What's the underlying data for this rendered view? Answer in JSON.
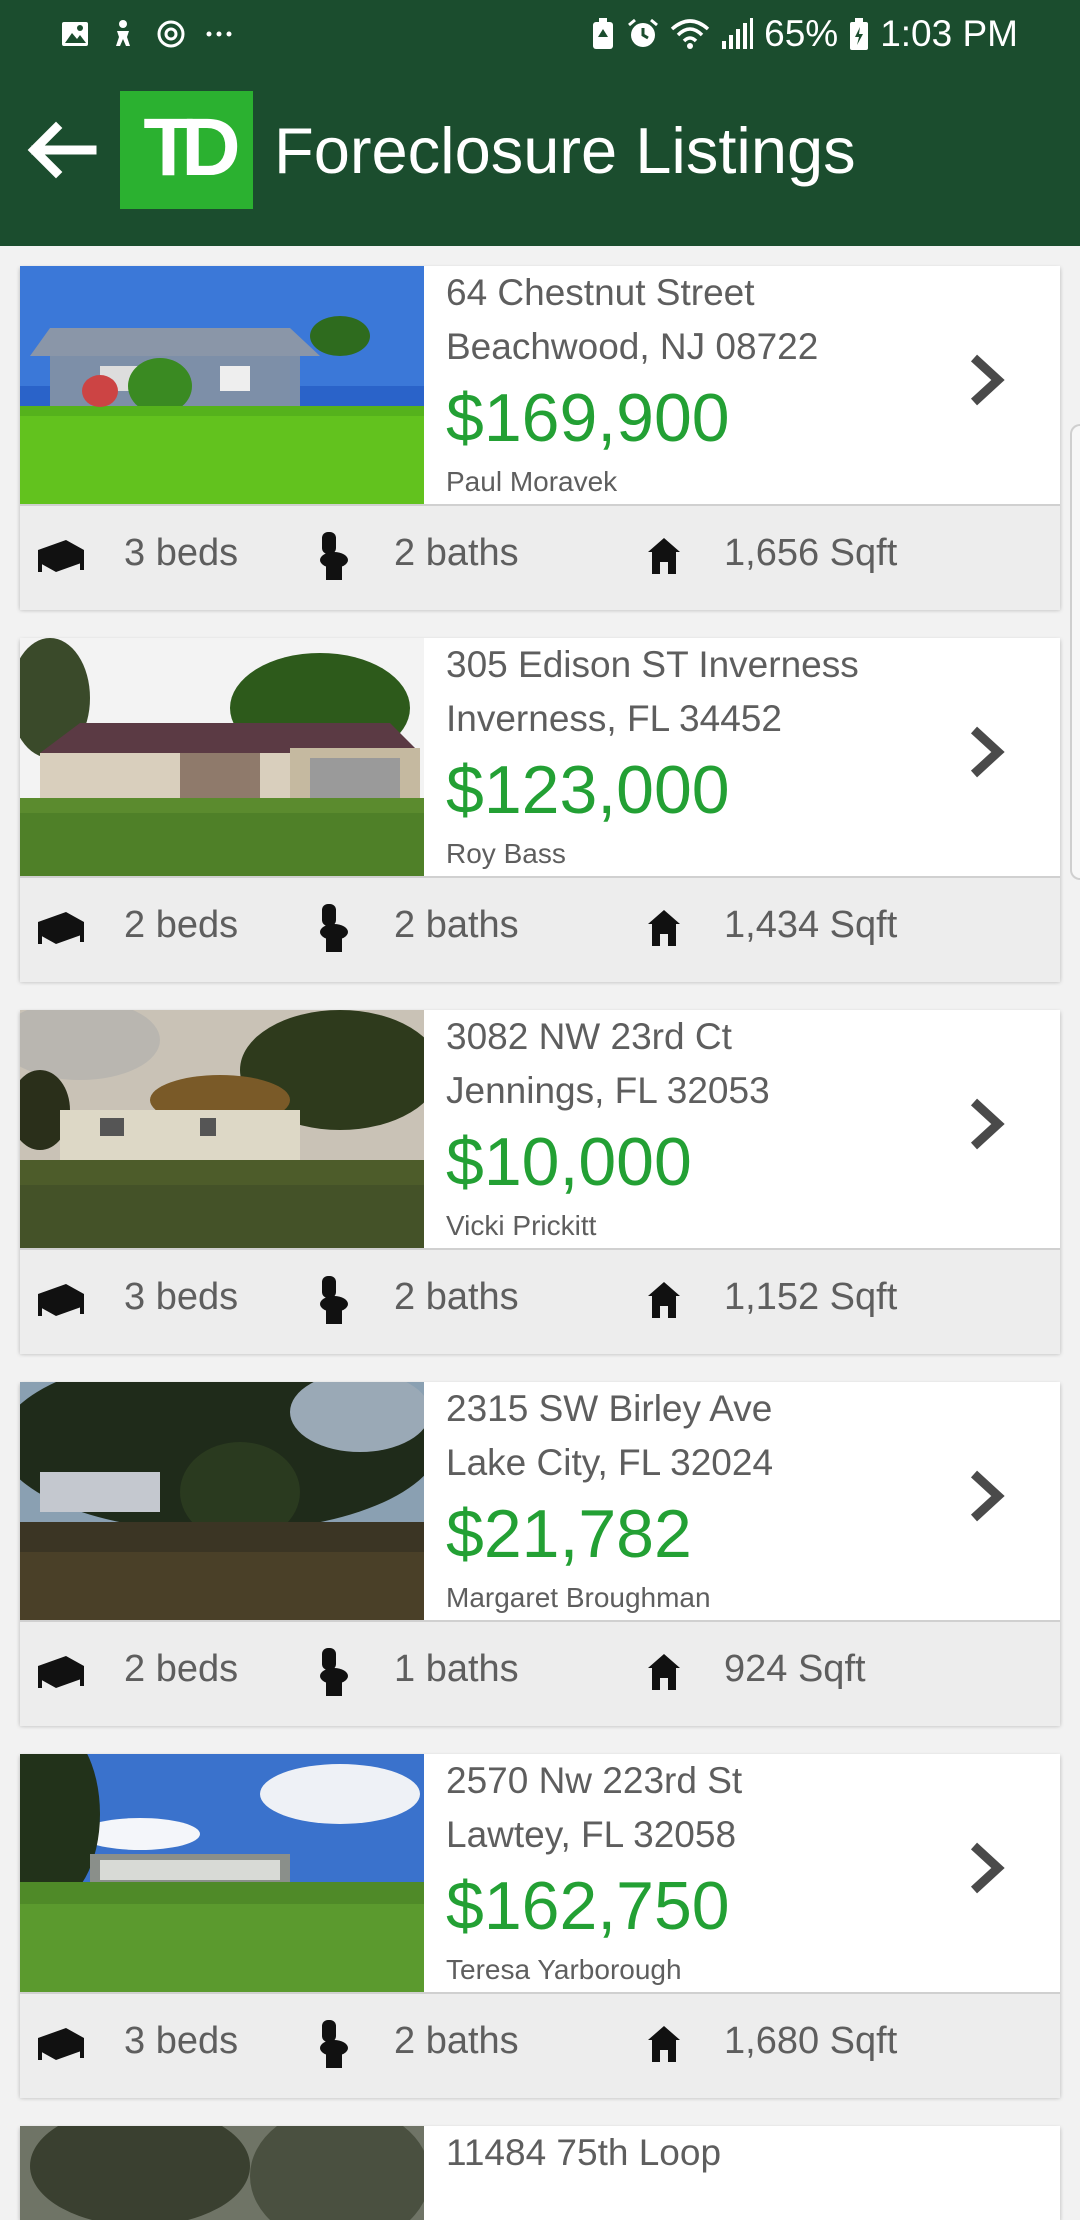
{
  "status_bar": {
    "battery": "65%",
    "time": "1:03 PM",
    "left_icons": [
      "image-icon",
      "accessibility-icon",
      "sync-icon",
      "more-icon"
    ],
    "right_icons": [
      "battery-saver-icon",
      "alarm-icon",
      "wifi-icon",
      "signal-icon",
      "battery-icon"
    ]
  },
  "app_bar": {
    "title": "Foreclosure Listings",
    "logo_text": "TD",
    "brand_color": "#2bb130",
    "bar_color": "#1b4d2e"
  },
  "listings": [
    {
      "address_line1": "64 Chestnut Street",
      "address_line2": "Beachwood, NJ 08722",
      "price": "$169,900",
      "agent": "Paul Moravek",
      "beds": "3 beds",
      "baths": "2 baths",
      "sqft": "1,656 Sqft"
    },
    {
      "address_line1": "305 Edison ST Inverness",
      "address_line2": "Inverness, FL 34452",
      "price": "$123,000",
      "agent": "Roy Bass",
      "beds": "2 beds",
      "baths": "2 baths",
      "sqft": "1,434 Sqft"
    },
    {
      "address_line1": "3082 NW 23rd Ct",
      "address_line2": "Jennings, FL 32053",
      "price": "$10,000",
      "agent": "Vicki Prickitt",
      "beds": "3 beds",
      "baths": "2 baths",
      "sqft": "1,152 Sqft"
    },
    {
      "address_line1": "2315 SW Birley Ave",
      "address_line2": "Lake City, FL 32024",
      "price": "$21,782",
      "agent": "Margaret Broughman",
      "beds": "2 beds",
      "baths": "1 baths",
      "sqft": "924 Sqft"
    },
    {
      "address_line1": "2570 Nw 223rd St",
      "address_line2": "Lawtey, FL 32058",
      "price": "$162,750",
      "agent": "Teresa Yarborough",
      "beds": "3 beds",
      "baths": "2 baths",
      "sqft": "1,680 Sqft"
    }
  ],
  "partial_listing": {
    "address_line1": "11484 75th Loop"
  },
  "colors": {
    "price": "#23a034",
    "text": "#5e5e5e",
    "stats_bg": "#ededed"
  }
}
